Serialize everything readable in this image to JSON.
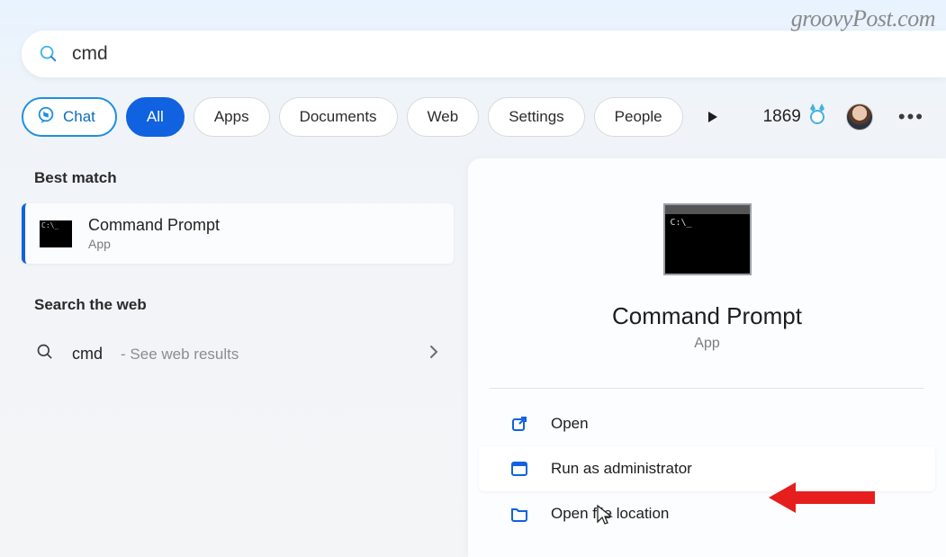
{
  "watermark": "groovyPost.com",
  "search": {
    "value": "cmd",
    "placeholder": ""
  },
  "filters": {
    "chat": "Chat",
    "all": "All",
    "apps": "Apps",
    "documents": "Documents",
    "web": "Web",
    "settings": "Settings",
    "people": "People"
  },
  "rewards": {
    "points": "1869"
  },
  "left": {
    "best_match_label": "Best match",
    "result": {
      "title": "Command Prompt",
      "subtitle": "App"
    },
    "web_label": "Search the web",
    "web_result": {
      "term": "cmd",
      "hint": "- See web results"
    }
  },
  "preview": {
    "title": "Command Prompt",
    "subtitle": "App",
    "actions": {
      "open": "Open",
      "run_admin": "Run as administrator",
      "open_location": "Open file location"
    }
  }
}
